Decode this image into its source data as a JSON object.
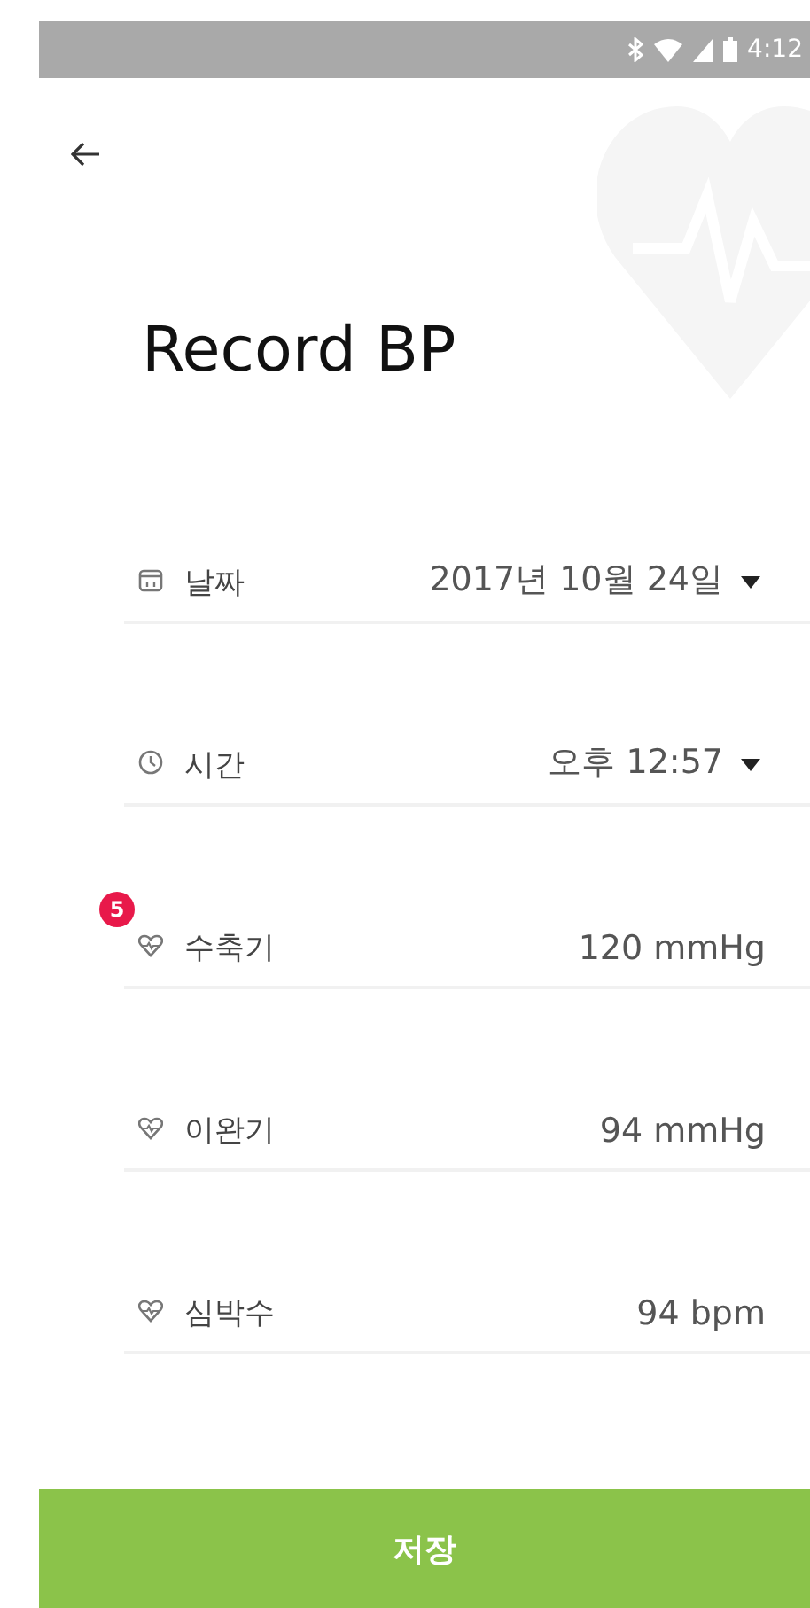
{
  "status_bar": {
    "time": "4:12"
  },
  "title": "Record BP",
  "rows": [
    {
      "kind": "dropdown",
      "label": "날짜",
      "value": "2017년 10월 24일"
    },
    {
      "kind": "dropdown",
      "label": "시간",
      "value": "오후 12:57"
    },
    {
      "kind": "reading",
      "label": "수축기",
      "value": "120 mmHg",
      "badge": "5"
    },
    {
      "kind": "reading",
      "label": "이완기",
      "value": "94 mmHg"
    },
    {
      "kind": "reading",
      "label": "심박수",
      "value": "94 bpm"
    }
  ],
  "save_button": "저장"
}
